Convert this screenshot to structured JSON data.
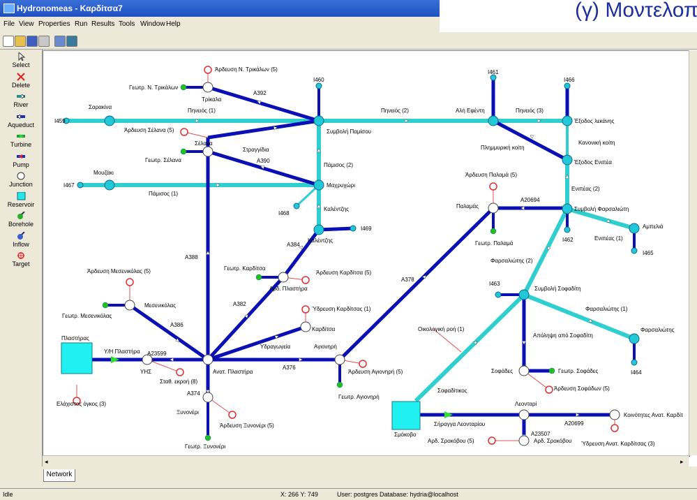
{
  "window": {
    "title": "Hydronomeas - Καρδίτσα7"
  },
  "slide_heading": "(γ) Μοντελοπο",
  "menu": [
    "File",
    "View",
    "Properties",
    "Run",
    "Results",
    "Tools",
    "Window",
    "Help"
  ],
  "palette": [
    {
      "label": "Select",
      "icon": "cursor-icon",
      "color": "#555555"
    },
    {
      "label": "Delete",
      "icon": "x-icon",
      "color": "#e02020"
    },
    {
      "label": "River",
      "icon": "river-icon",
      "color": "#2a8f8f"
    },
    {
      "label": "Aqueduct",
      "icon": "aqueduct-icon",
      "color": "#1a2fc0"
    },
    {
      "label": "Turbine",
      "icon": "turbine-icon",
      "color": "#1a9a3a"
    },
    {
      "label": "Pump",
      "icon": "pump-icon",
      "color": "#c0203a"
    },
    {
      "label": "Junction",
      "icon": "circle-icon",
      "color": "#ffffff"
    },
    {
      "label": "Reservoir",
      "icon": "square-icon",
      "color": "#25e6e6"
    },
    {
      "label": "Borehole",
      "icon": "borehole-icon",
      "color": "#2ab02a"
    },
    {
      "label": "Inflow",
      "icon": "inflow-icon",
      "color": "#3a5fd0"
    },
    {
      "label": "Target",
      "icon": "target-icon",
      "color": "#e02020"
    }
  ],
  "colors": {
    "aqueduct": "#0a10b4",
    "river": "#30cfcf",
    "junction_fill": "#ffffff",
    "boundary": "#20c8d8",
    "borehole": "#20c020",
    "target": "#e03030",
    "reservoir": "#20f0f0"
  },
  "map_labels": [
    "Άρδευση Ν. Τρικάλων (5)",
    "Γεωτρ. Ν. Τρικάλων",
    "Τρίκαλα",
    "Α392",
    "Ι460",
    "Σαρακίνα",
    "Πηνειός (1)",
    "Ι459",
    "Συμβολή Παμίσου",
    "Πηνειός (2)",
    "Αλή Εφέντη",
    "Ι461",
    "Πηνειός (3)",
    "Ι466",
    "Έξοδος λεκάνης",
    "Κανονική κοίτη",
    "Πλημμυρική κοίτη",
    "Έξοδος Ενιπέα",
    "Άρδευση Σέλανα (5)",
    "Σέλανα",
    "Στραγγίδια",
    "Γεωτρ. Σέλανα",
    "Α390",
    "Πάμισος (2)",
    "Μουζάκι",
    "Ι467",
    "Πάμισος (1)",
    "Μαχρυχώρι",
    "Ι468",
    "Καλέντζης",
    "Καλέντζης",
    "Ι469",
    "Άρδευση Παλαμά (5)",
    "Παλαμάς",
    "Α20694",
    "Ενιπέας (2)",
    "Συμβολή Φαρσαλιώτη",
    "Γεωτρ. Παλαμά",
    "Ι462",
    "Αμπελιά",
    "Ενιπέας (1)",
    "Ι465",
    "Α388",
    "Α384",
    "Γεωτρ. Καρδίτσα",
    "Αρδ. Πλαστήρα",
    "Άρδευση Καρδίτσα (5)",
    "Α378",
    "Φαρσαλιώτης (2)",
    "Άρδευση Μεσενικόλας (5)",
    "Μεσενικόλας",
    "Γεωτρ. Μεσενικόλας",
    "Α382",
    "Ύδρευση Καρδίτσας (1)",
    "Καρδίτσα",
    "Ι463",
    "Συμβολή Σοφαδίτη",
    "Φαρσαλιώτης (1)",
    "Α386",
    "Υδραγωγεία",
    "Πλαστήρας",
    "Υ/Η Πλαστήρα",
    "Α23599",
    "ΥΗΣ",
    "Αγιονηρή",
    "Ανατ. Πλαστήρα",
    "Α376",
    "Άρδευση Αγιονηρή (5)",
    "Σταθ. εκροή (8)",
    "Οικολογική ροή (1)",
    "Απόληψη από Σοφαδίτη",
    "Φαρσαλιώτης",
    "Σοφάδες",
    "Γεωτρ. Σοφάδες",
    "Ι464",
    "Γεωτρ. Αγιονηρή",
    "Α374",
    "Άρδευση Σοφάδων (5)",
    "Ελάχιστος όγκος (3)",
    "Σοφαδίτικος",
    "Ξυνονέρι",
    "Άρδευση Ξυνονέρι (5)",
    "Λεονταρί",
    "Σμόκοβο",
    "Σήραγγα Λεονταρίου",
    "Α20699",
    "Κοινότητες Ανατ. Καρδίτ",
    "Α23507",
    "Ύδρευση Ανατ. Καρδίτσας (3)",
    "Γεωτρ. Ξυνονέρι",
    "Αρδ. Σροκόβου (5)",
    "Αρδ. Σροκόβου"
  ],
  "tab": "Network",
  "status": {
    "state": "Idle",
    "coords": "X: 266 Y: 749",
    "user": "User: postgres  Database: hydria@localhost"
  }
}
